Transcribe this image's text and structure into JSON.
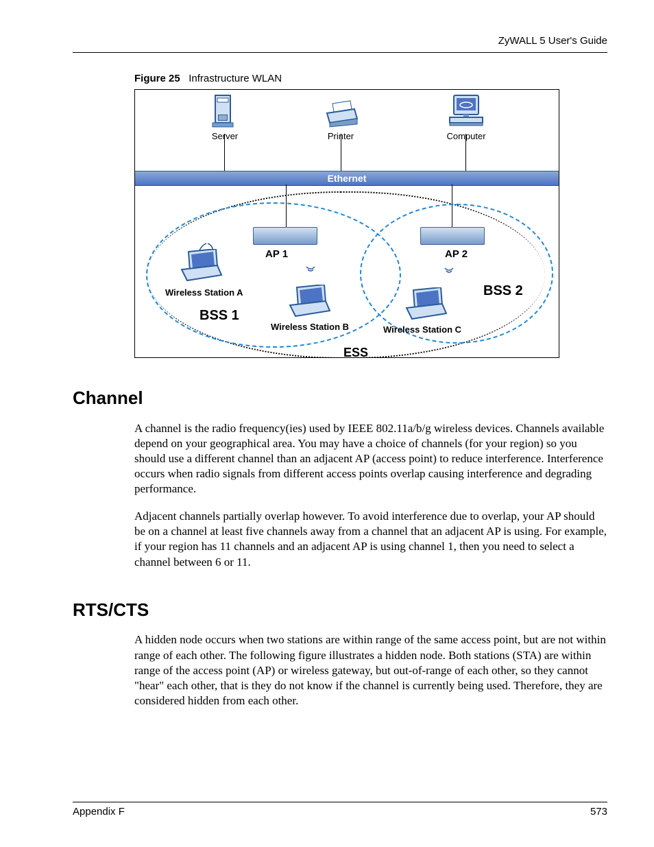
{
  "header_text": "ZyWALL 5 User's Guide",
  "figure_caption_label": "Figure 25",
  "figure_caption_text": "Infrastructure WLAN",
  "figure": {
    "server": "Server",
    "printer": "Printer",
    "computer": "Computer",
    "ethernet": "Ethernet",
    "ap1": "AP 1",
    "ap2": "AP 2",
    "wsA": "Wireless Station A",
    "wsB": "Wireless Station B",
    "wsC": "Wireless Station C",
    "bss1": "BSS 1",
    "bss2": "BSS 2",
    "ess": "ESS"
  },
  "section1_title": "Channel",
  "section1_p1": "A channel is the radio frequency(ies) used by IEEE 802.11a/b/g wireless devices. Channels available depend on your geographical area. You may have a choice of channels (for your region) so you should use a different channel than an adjacent AP (access point) to reduce interference. Interference occurs when radio signals from different access points overlap causing interference and degrading performance.",
  "section1_p2": "Adjacent channels partially overlap however. To avoid interference due to overlap, your AP should be on a channel at least five channels away from a channel that an adjacent AP is using. For example, if your region has 11 channels and an adjacent AP is using channel 1, then you need to select a channel between 6 or 11.",
  "section2_title": "RTS/CTS",
  "section2_p1": "A hidden node occurs when two stations are within range of the same access point, but are not within range of each other. The following figure illustrates a hidden node. Both stations (STA) are within range of the access point (AP) or wireless gateway, but out-of-range of each other, so they cannot \"hear\" each other, that is they do not know if the channel is currently being used. Therefore, they are considered hidden from each other.",
  "footer_left": "Appendix F",
  "footer_right": "573"
}
